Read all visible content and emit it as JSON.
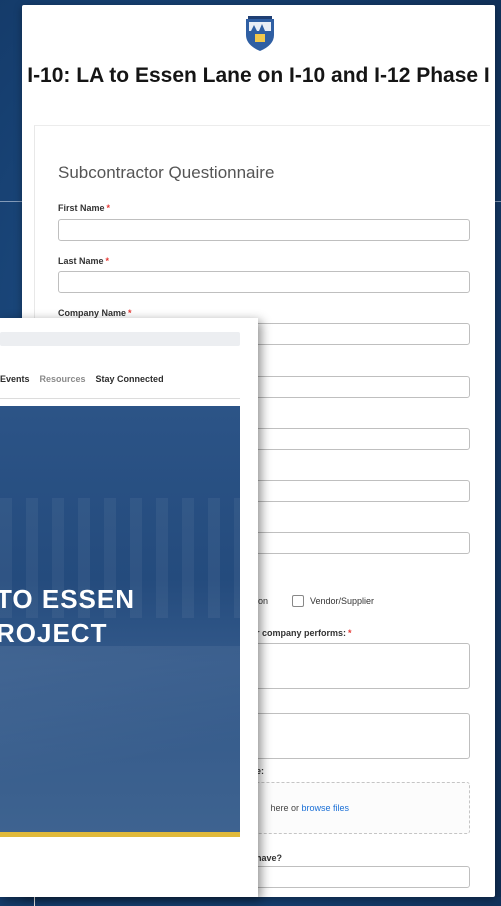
{
  "form": {
    "project_title": "I-10: LA to Essen Lane on I-10 and I-12 Phase I",
    "heading": "Subcontractor Questionnaire",
    "required_marker": "*",
    "labels": {
      "first_name": "First Name",
      "last_name": "Last Name",
      "company_name": "Company Name",
      "performs_partial": "r company performs:",
      "upload_partial": "e:",
      "have_partial": "have?"
    },
    "checkboxes": {
      "partial_option": "on",
      "vendor_supplier": "Vendor/Supplier"
    },
    "upload": {
      "text": "here or ",
      "link": "browse files"
    }
  },
  "website": {
    "nav": {
      "events": "Events",
      "resources": "Resources",
      "stay_connected": "Stay Connected"
    },
    "hero_title": "TO ESSEN\nROJECT"
  },
  "colors": {
    "background": "#163f70",
    "required": "#e53935",
    "link": "#1a6fd6",
    "hero": "#2c5487",
    "stripe": "#e0b93a"
  }
}
